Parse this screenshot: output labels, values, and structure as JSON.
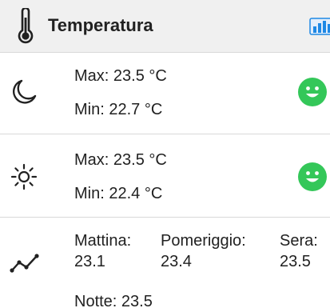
{
  "header": {
    "title": "Temperatura",
    "icon": "thermometer-icon",
    "chart_button_icon": "bar-chart-icon",
    "accent_color": "#1e88e5"
  },
  "night": {
    "icon": "moon-icon",
    "max": "Max: 23.5 °C",
    "min": "Min: 22.7 °C",
    "status_icon": "smiley-icon",
    "status_color": "#34c759"
  },
  "day": {
    "icon": "sun-icon",
    "max": "Max: 23.5 °C",
    "min": "Min: 22.4 °C",
    "status_icon": "smiley-icon",
    "status_color": "#34c759"
  },
  "trend": {
    "icon": "trend-line-icon",
    "mattina_label": "Mattina:",
    "mattina_value": "23.1",
    "pomeriggio_label": "Pomeriggio:",
    "pomeriggio_value": "23.4",
    "sera_label": "Sera:",
    "sera_value": "23.5",
    "notte": "Notte: 23.5"
  }
}
